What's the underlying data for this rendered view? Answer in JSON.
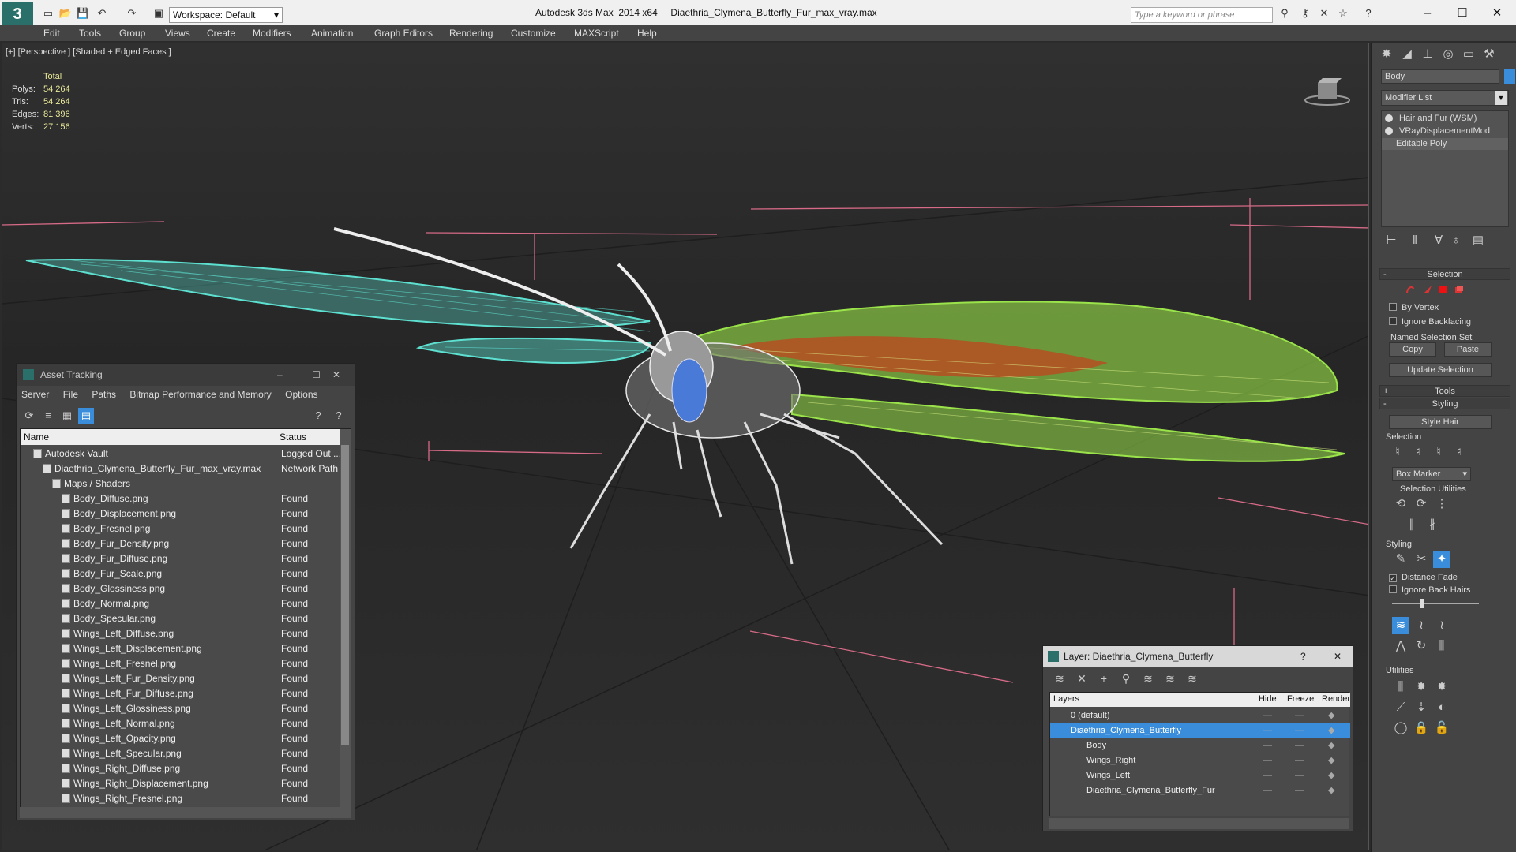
{
  "titlebar": {
    "workspace": "Workspace: Default",
    "app_title": "Autodesk 3ds Max  2014 x64     Diaethria_Clymena_Butterfly_Fur_max_vray.max",
    "search_placeholder": "Type a keyword or phrase"
  },
  "menu": [
    "Edit",
    "Tools",
    "Group",
    "Views",
    "Create",
    "Modifiers",
    "Animation",
    "Graph Editors",
    "Rendering",
    "Customize",
    "MAXScript",
    "Help"
  ],
  "viewport": {
    "label": "[+] [Perspective ] [Shaded + Edged Faces ]",
    "stats": {
      "header": "Total",
      "polys_label": "Polys:",
      "polys": "54 264",
      "tris_label": "Tris:",
      "tris": "54 264",
      "edges_label": "Edges:",
      "edges": "81 396",
      "verts_label": "Verts:",
      "verts": "27 156"
    }
  },
  "command_panel": {
    "object_name": "Body",
    "modifier_list": "Modifier List",
    "stack": [
      "Hair and Fur (WSM)",
      "VRayDisplacementMod",
      "Editable Poly"
    ],
    "selection_title": "Selection",
    "by_vertex": "By Vertex",
    "ignore_backfacing": "Ignore Backfacing",
    "named_selection_set": "Named Selection Set",
    "copy": "Copy",
    "paste": "Paste",
    "update_selection": "Update Selection",
    "tools_title": "Tools",
    "styling_title": "Styling",
    "style_hair": "Style Hair",
    "selection_sub": "Selection",
    "box_marker": "Box Marker",
    "selection_utilities": "Selection Utilities",
    "styling_sub": "Styling",
    "distance_fade": "Distance Fade",
    "ignore_back_hairs": "Ignore Back Hairs",
    "utilities_sub": "Utilities"
  },
  "asset_tracking": {
    "title": "Asset Tracking",
    "menu": [
      "Server",
      "File",
      "Paths",
      "Bitmap Performance and Memory",
      "Options"
    ],
    "col_name": "Name",
    "col_status": "Status",
    "rows": [
      {
        "name": "Autodesk Vault",
        "status": "Logged Out ...",
        "level": 1
      },
      {
        "name": "Diaethria_Clymena_Butterfly_Fur_max_vray.max",
        "status": "Network Path",
        "level": 2
      },
      {
        "name": "Maps / Shaders",
        "status": "",
        "level": 3
      },
      {
        "name": "Body_Diffuse.png",
        "status": "Found",
        "level": 4
      },
      {
        "name": "Body_Displacement.png",
        "status": "Found",
        "level": 4
      },
      {
        "name": "Body_Fresnel.png",
        "status": "Found",
        "level": 4
      },
      {
        "name": "Body_Fur_Density.png",
        "status": "Found",
        "level": 4
      },
      {
        "name": "Body_Fur_Diffuse.png",
        "status": "Found",
        "level": 4
      },
      {
        "name": "Body_Fur_Scale.png",
        "status": "Found",
        "level": 4
      },
      {
        "name": "Body_Glossiness.png",
        "status": "Found",
        "level": 4
      },
      {
        "name": "Body_Normal.png",
        "status": "Found",
        "level": 4
      },
      {
        "name": "Body_Specular.png",
        "status": "Found",
        "level": 4
      },
      {
        "name": "Wings_Left_Diffuse.png",
        "status": "Found",
        "level": 4
      },
      {
        "name": "Wings_Left_Displacement.png",
        "status": "Found",
        "level": 4
      },
      {
        "name": "Wings_Left_Fresnel.png",
        "status": "Found",
        "level": 4
      },
      {
        "name": "Wings_Left_Fur_Density.png",
        "status": "Found",
        "level": 4
      },
      {
        "name": "Wings_Left_Fur_Diffuse.png",
        "status": "Found",
        "level": 4
      },
      {
        "name": "Wings_Left_Glossiness.png",
        "status": "Found",
        "level": 4
      },
      {
        "name": "Wings_Left_Normal.png",
        "status": "Found",
        "level": 4
      },
      {
        "name": "Wings_Left_Opacity.png",
        "status": "Found",
        "level": 4
      },
      {
        "name": "Wings_Left_Specular.png",
        "status": "Found",
        "level": 4
      },
      {
        "name": "Wings_Right_Diffuse.png",
        "status": "Found",
        "level": 4
      },
      {
        "name": "Wings_Right_Displacement.png",
        "status": "Found",
        "level": 4
      },
      {
        "name": "Wings_Right_Fresnel.png",
        "status": "Found",
        "level": 4
      }
    ]
  },
  "layer_explorer": {
    "title": "Layer: Diaethria_Clymena_Butterfly",
    "col_layers": "Layers",
    "col_hide": "Hide",
    "col_freeze": "Freeze",
    "col_render": "Render",
    "rows": [
      {
        "name": "0 (default)",
        "level": 1,
        "selected": false
      },
      {
        "name": "Diaethria_Clymena_Butterfly",
        "level": 1,
        "selected": true
      },
      {
        "name": "Body",
        "level": 2,
        "selected": false
      },
      {
        "name": "Wings_Right",
        "level": 2,
        "selected": false
      },
      {
        "name": "Wings_Left",
        "level": 2,
        "selected": false
      },
      {
        "name": "Diaethria_Clymena_Butterfly_Fur",
        "level": 2,
        "selected": false
      }
    ]
  },
  "colors": {
    "accent": "#3a8ddb",
    "wing_left": "#5ee0d0",
    "wing_right": "#9be34a",
    "wing_right_inner": "#c0461f"
  }
}
